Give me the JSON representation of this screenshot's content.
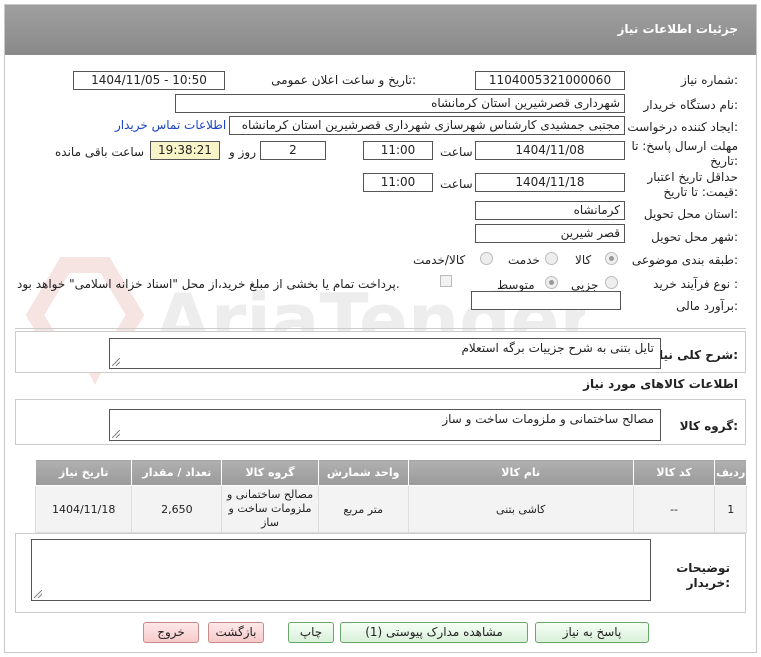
{
  "header": {
    "title": "جزئیات اطلاعات نیاز"
  },
  "form": {
    "need_number_label": "شماره نیاز:",
    "need_number": "1104005321000060",
    "announce_label": "تاریخ و ساعت اعلان عمومی:",
    "announce_value": "1404/11/05 - 10:50",
    "buyer_org_label": "نام دستگاه خریدار:",
    "buyer_org": "شهرداری قصرشیرین استان کرمانشاه",
    "creator_label": "ایجاد کننده درخواست:",
    "creator": "مجتبی جمشیدی کارشناس شهرسازی شهرداری قصرشیرین استان کرمانشاه",
    "contact_link": "اطلاعات تماس خریدار",
    "deadline_label_1": "مهلت ارسال پاسخ: تا",
    "deadline_label_2": "تاریخ:",
    "deadline_date": "1404/11/08",
    "time_label": "ساعت",
    "deadline_time": "11:00",
    "days": "2",
    "days_label": "روز و",
    "remaining_time": "19:38:21",
    "remaining_label": "ساعت باقی مانده",
    "validity_label_1": "حداقل تاریخ اعتبار",
    "validity_label_2": "قیمت: تا تاریخ:",
    "validity_date": "1404/11/18",
    "validity_time": "11:00",
    "province_label": "استان محل تحویل:",
    "province": "کرمانشاه",
    "city_label": "شهر محل تحویل:",
    "city": "قصر شیرین",
    "category_label": "طبقه بندی موضوعی:",
    "category_options": [
      "کالا",
      "خدمت",
      "کالا/خدمت"
    ],
    "category_selected": "کالا",
    "process_label": "نوع فرآیند خرید :",
    "process_options": [
      "جزیی",
      "متوسط"
    ],
    "payment_note": "پرداخت تمام یا بخشی از مبلغ خرید،از محل \"اسناد خزانه اسلامی\" خواهد بود.",
    "budget_label": "برآورد مالی:",
    "budget_value": ""
  },
  "summary": {
    "label": "شرح کلی نیاز:",
    "value": "تایل بتنی به شرح جزییات برگه استعلام"
  },
  "goods": {
    "section_title": "اطلاعات کالاهای مورد نیاز",
    "group_label": "گروه کالا:",
    "group_value": "مصالح ساختمانی و ملزومات ساخت و ساز",
    "columns": [
      "ردیف",
      "کد کالا",
      "نام کالا",
      "واحد شمارش",
      "گروه کالا",
      "تعداد / مقدار",
      "تاریخ نیاز"
    ],
    "rows": [
      [
        "1",
        "--",
        "کاشی بتنی",
        "متر مربع",
        "مصالح ساختمانی و ملزومات ساخت و ساز",
        "2,650",
        "1404/11/18"
      ]
    ]
  },
  "notes": {
    "label_1": "توضیحات",
    "label_2": "خریدار:",
    "value": ""
  },
  "buttons": {
    "reply": "پاسخ به نیاز",
    "docs": "مشاهده مدارک پیوستی (1)",
    "print": "چاپ",
    "back": "بازگشت",
    "exit": "خروج"
  },
  "watermark_text": "AriaTender.neT"
}
